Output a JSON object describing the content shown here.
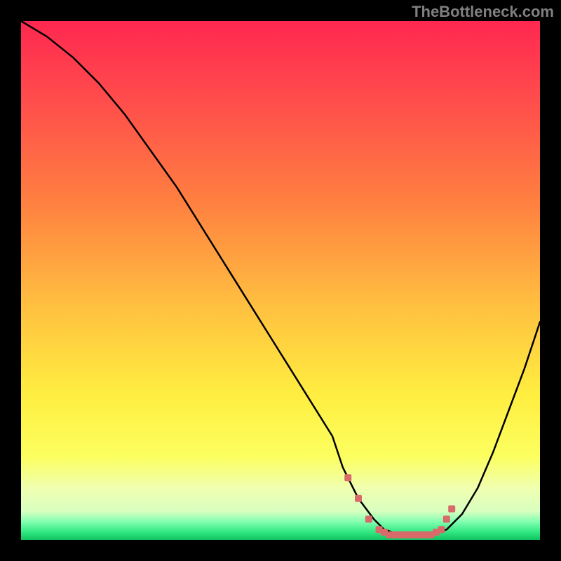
{
  "watermark": "TheBottleneck.com",
  "chart_data": {
    "type": "line",
    "title": "",
    "xlabel": "",
    "ylabel": "",
    "xlim": [
      0,
      100
    ],
    "ylim": [
      0,
      100
    ],
    "series": [
      {
        "name": "bottleneck-curve",
        "x": [
          0,
          5,
          10,
          15,
          20,
          25,
          30,
          35,
          40,
          45,
          50,
          55,
          60,
          62,
          65,
          68,
          70,
          73,
          76,
          79,
          82,
          85,
          88,
          91,
          94,
          97,
          100
        ],
        "values": [
          100,
          97,
          93,
          88,
          82,
          75,
          68,
          60,
          52,
          44,
          36,
          28,
          20,
          14,
          8,
          4,
          2,
          1,
          1,
          1,
          2,
          5,
          10,
          17,
          25,
          33,
          42
        ]
      }
    ],
    "markers": {
      "name": "optimal-zone",
      "color": "#d86a6a",
      "x": [
        63,
        65,
        67,
        69,
        70,
        71,
        72,
        73,
        74,
        75,
        76,
        77,
        78,
        79,
        80,
        81,
        82,
        83
      ],
      "values": [
        12,
        8,
        4,
        2,
        1.5,
        1,
        1,
        1,
        1,
        1,
        1,
        1,
        1,
        1,
        1.5,
        2,
        4,
        6
      ]
    },
    "gradient_stops": [
      {
        "offset": 0,
        "color": "#ff2850"
      },
      {
        "offset": 0.15,
        "color": "#ff4c4c"
      },
      {
        "offset": 0.35,
        "color": "#ff8040"
      },
      {
        "offset": 0.55,
        "color": "#ffc040"
      },
      {
        "offset": 0.72,
        "color": "#ffee40"
      },
      {
        "offset": 0.84,
        "color": "#fcff60"
      },
      {
        "offset": 0.9,
        "color": "#f0ffb0"
      },
      {
        "offset": 0.945,
        "color": "#d8ffc0"
      },
      {
        "offset": 0.965,
        "color": "#80ffb0"
      },
      {
        "offset": 0.985,
        "color": "#30e880"
      },
      {
        "offset": 1.0,
        "color": "#10c060"
      }
    ]
  }
}
